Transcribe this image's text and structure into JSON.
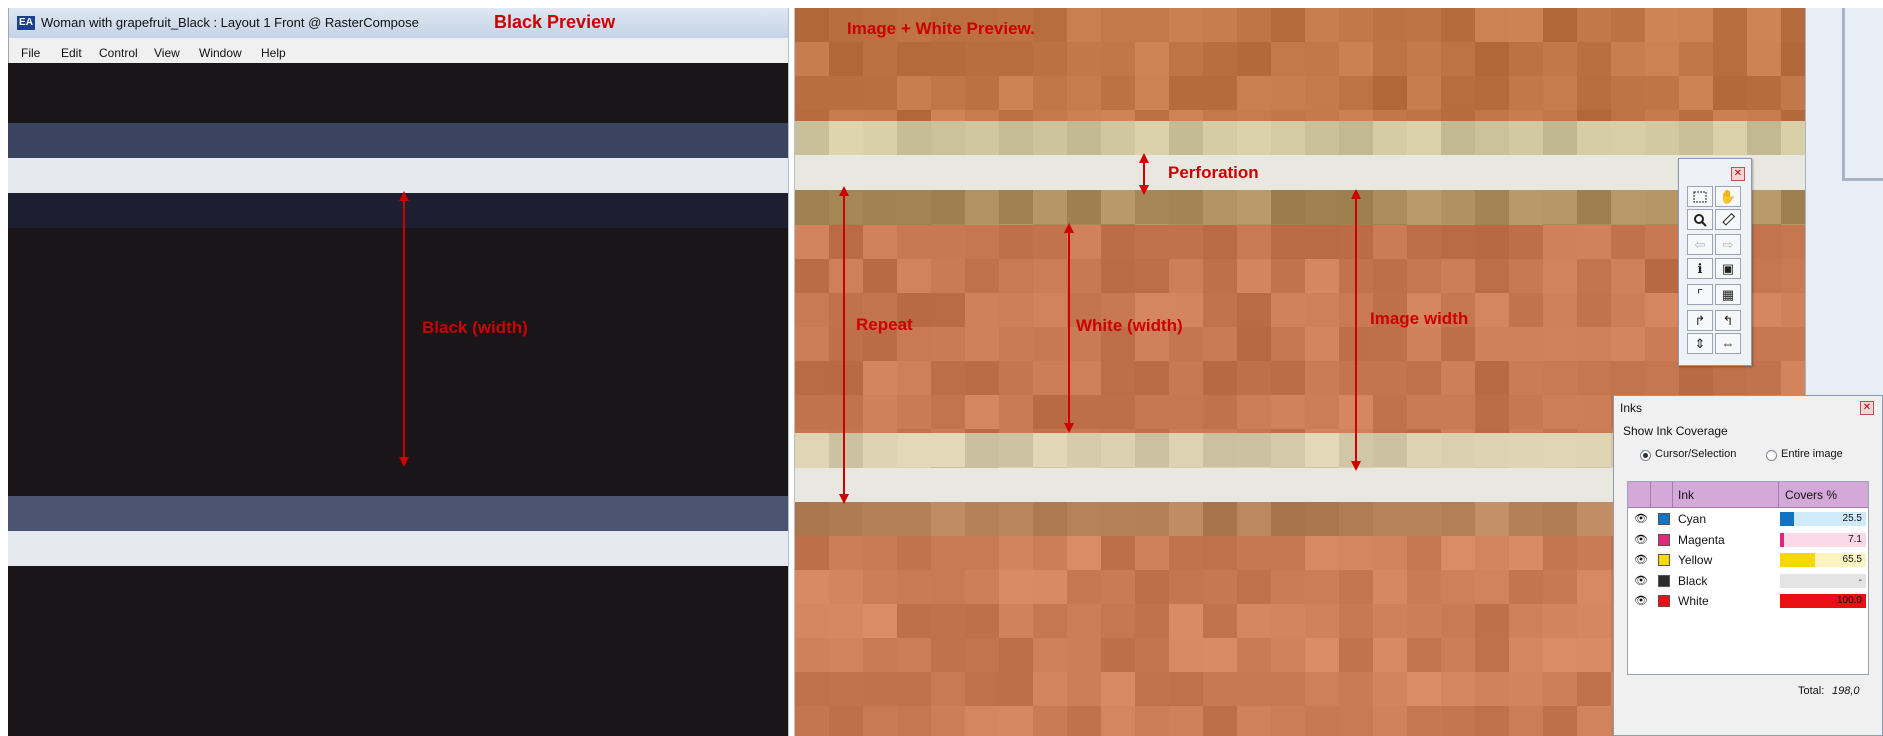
{
  "window": {
    "title": "Woman with grapefruit_Black : Layout 1 Front @ RasterCompose",
    "logo_text": "EA",
    "preview_label": "Black Preview"
  },
  "menu": [
    "File",
    "Edit",
    "Control",
    "View",
    "Window",
    "Help"
  ],
  "annotations": {
    "right_preview": "Image + White Preview.",
    "perforation": "Perforation",
    "black_width": "Black (width)",
    "repeat": "Repeat",
    "white_width": "White (width)",
    "image_width": "Image width"
  },
  "colors": {
    "annotation": "#cc0000",
    "black_bg": "#1a1519",
    "white_band": "#e6e6e0",
    "image_base": "#c07a4c"
  },
  "tools_palette": {
    "icons": [
      "marquee-icon",
      "hand-icon",
      "zoom-icon",
      "ruler-icon",
      "arrow-left-icon",
      "arrow-right-icon",
      "info-icon",
      "frame-icon",
      "corner-icon",
      "grid-icon",
      "rotate-right-icon",
      "rotate-left-icon",
      "flip-vertical-icon",
      "flip-horizontal-icon"
    ]
  },
  "inks_panel": {
    "title": "Inks",
    "show_label": "Show Ink Coverage",
    "options": [
      "Cursor/Selection",
      "Entire image"
    ],
    "selected_option": "Cursor/Selection",
    "columns": [
      "Ink",
      "Covers %"
    ],
    "inks": [
      {
        "name": "Cyan",
        "color": "#1273c4",
        "coverage": "25.5",
        "fraction": 0.255,
        "bar_bg": "#cfeafa"
      },
      {
        "name": "Magenta",
        "color": "#e0297a",
        "coverage": "7.1",
        "fraction": 0.071,
        "bar_bg": "#fbd8e6"
      },
      {
        "name": "Yellow",
        "color": "#f4d800",
        "coverage": "65.5",
        "fraction": 0.655,
        "bar_bg": "#fbf4c2"
      },
      {
        "name": "Black",
        "color": "#2b2b2b",
        "coverage": "-",
        "fraction": 0,
        "bar_bg": "#e4e4e4"
      },
      {
        "name": "White",
        "color": "#e81010",
        "coverage": "100.0",
        "fraction": 1.0,
        "bar_bg": "#e81010"
      }
    ],
    "total_label": "Total:",
    "total_value": "198,0"
  }
}
